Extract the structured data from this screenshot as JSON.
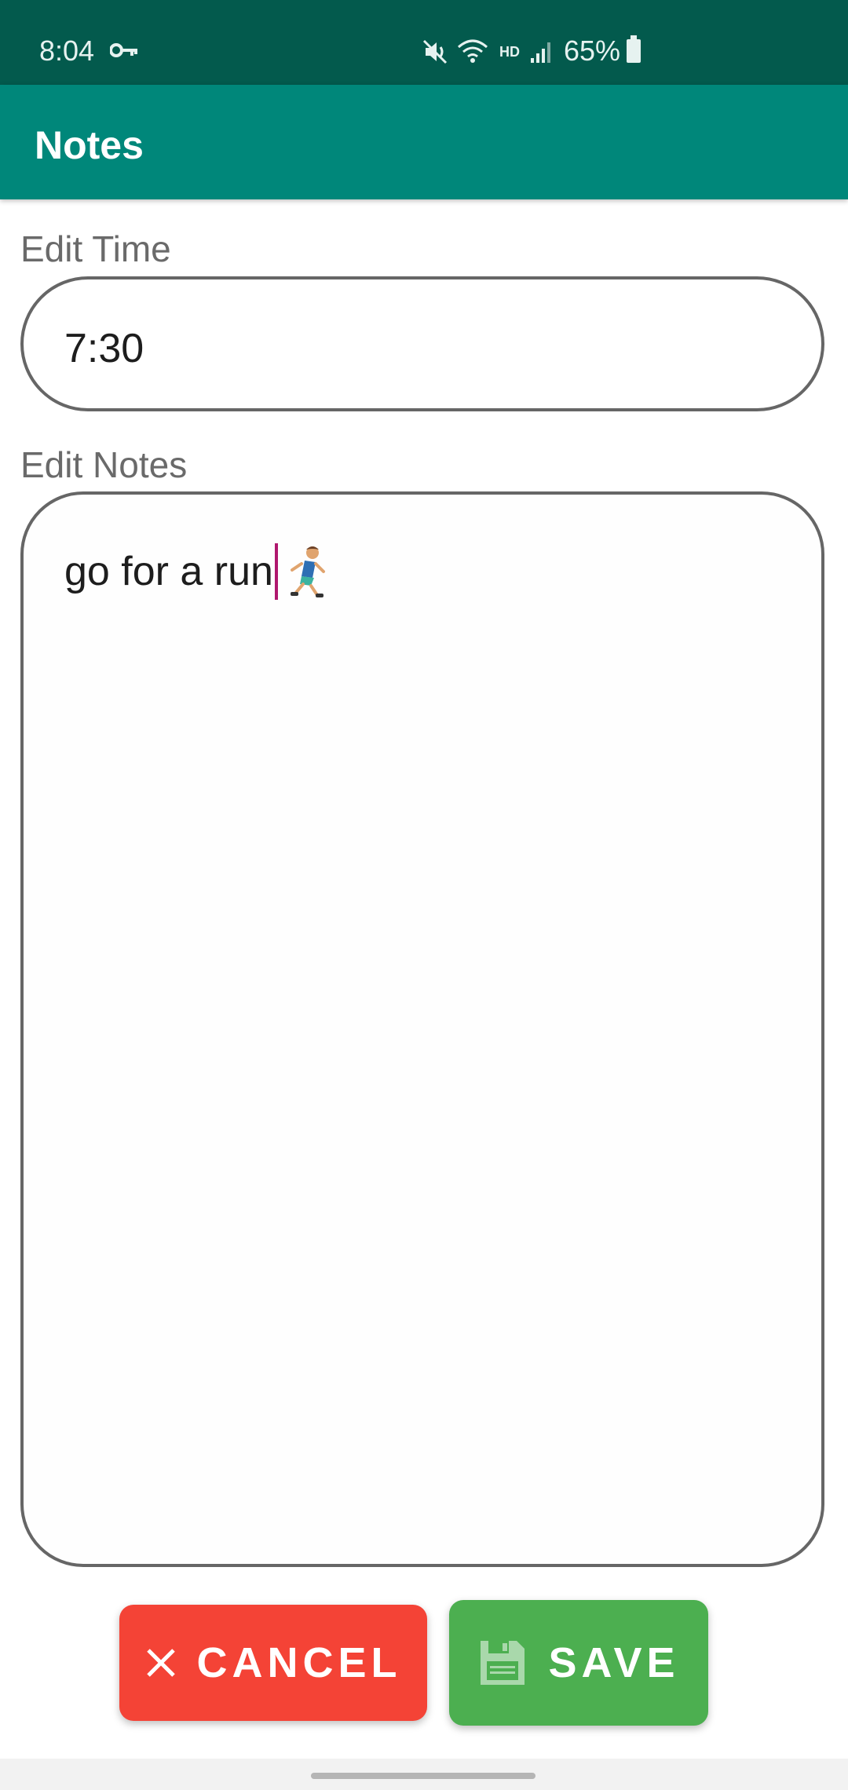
{
  "status_bar": {
    "time": "8:04",
    "battery": "65%",
    "network": "HD",
    "icons": [
      "key-icon",
      "mute-icon",
      "wifi-icon",
      "signal-icon",
      "battery-icon"
    ]
  },
  "app_bar": {
    "title": "Notes"
  },
  "form": {
    "time_label": "Edit Time",
    "time_value": "7:30",
    "notes_label": "Edit Notes",
    "notes_value": "go for a run"
  },
  "buttons": {
    "cancel_label": "CANCEL",
    "save_label": "SAVE"
  },
  "colors": {
    "status_bar": "#035A4D",
    "app_bar": "#00877A",
    "cancel": "#F44336",
    "save": "#4CAF50",
    "caret": "#B0176E"
  }
}
